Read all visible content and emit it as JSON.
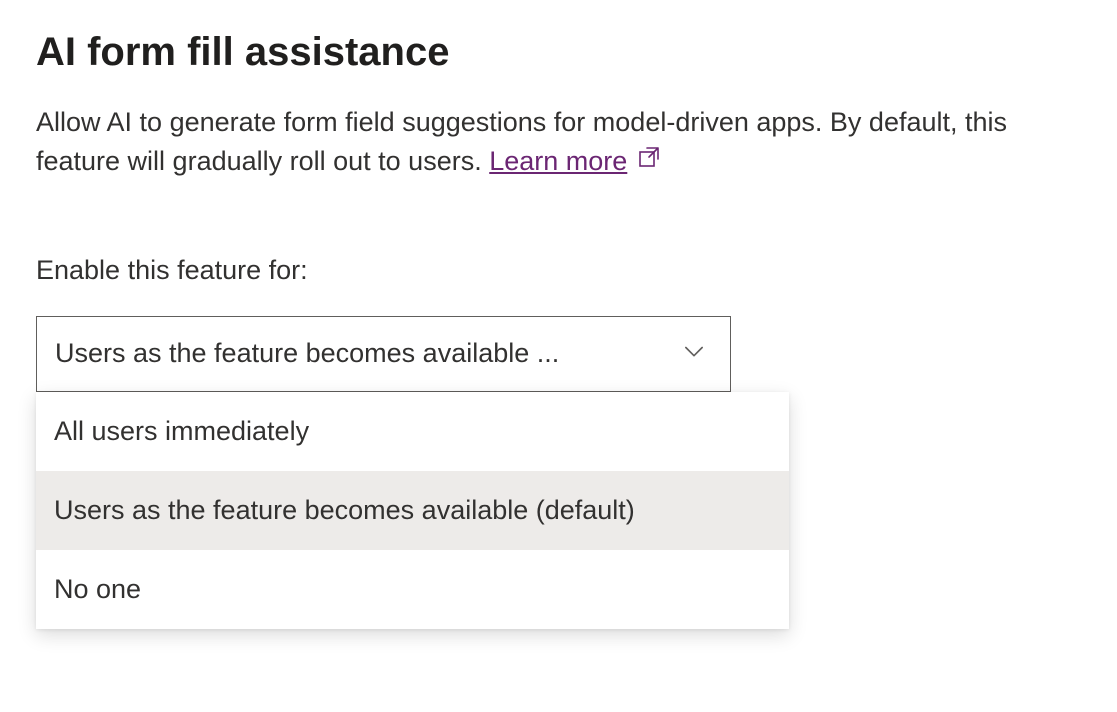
{
  "title": "AI form fill assistance",
  "description": {
    "text": "Allow AI to generate form field suggestions for model-driven apps. By default, this feature will gradually roll out to users. ",
    "link_text": "Learn more"
  },
  "section_label": "Enable this feature for:",
  "select": {
    "display": "Users as the feature becomes available ...",
    "options": [
      "All users immediately",
      "Users as the feature becomes available (default)",
      "No one"
    ],
    "selected_index": 1
  }
}
